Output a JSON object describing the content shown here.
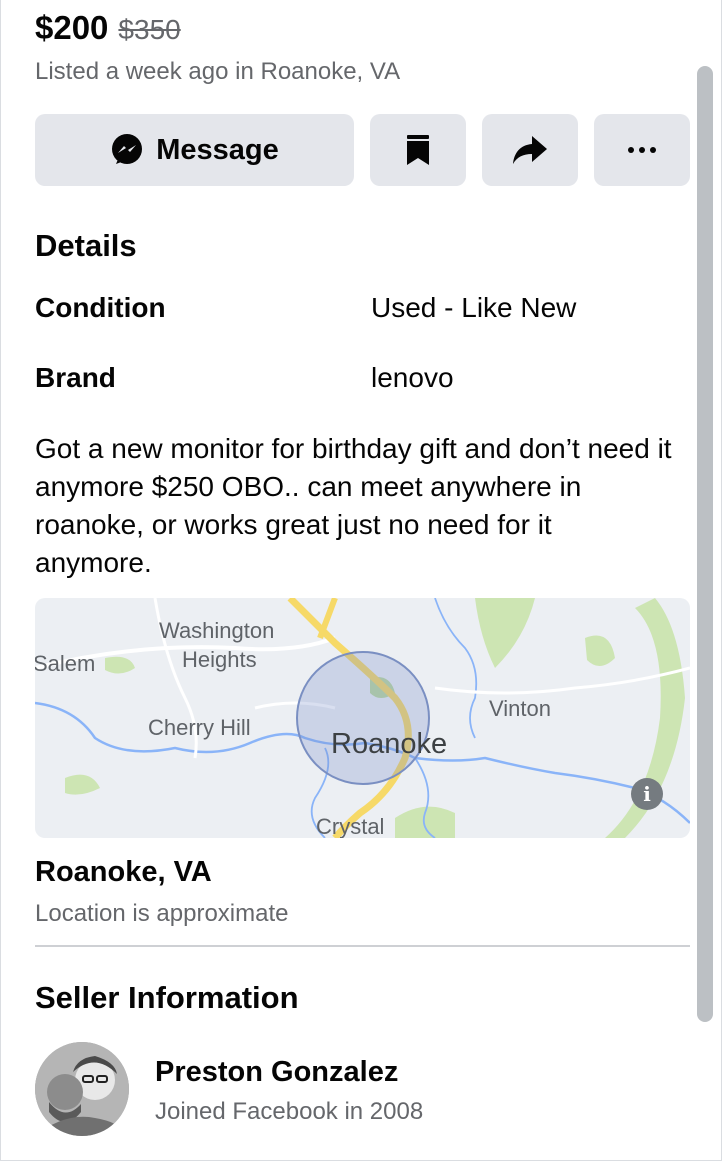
{
  "listing": {
    "price": "$200",
    "original_price": "$350",
    "listed_text": "Listed a week ago in Roanoke, VA"
  },
  "actions": {
    "message_label": "Message",
    "message_icon": "messenger-icon",
    "save_icon": "bookmark-icon",
    "share_icon": "share-arrow-icon",
    "more_icon": "more-dots-icon"
  },
  "details": {
    "title": "Details",
    "rows": [
      {
        "label": "Condition",
        "value": "Used - Like New"
      },
      {
        "label": "Brand",
        "value": "lenovo"
      }
    ],
    "description": "Got a new monitor for birthday gift and don’t need it anymore $250 OBO.. can meet anywhere in roanoke, or works great just no need for it anymore."
  },
  "map": {
    "labels": {
      "washington": "Washington",
      "heights": "Heights",
      "salem": "Salem",
      "cherry_hill": "Cherry Hill",
      "vinton": "Vinton",
      "roanoke": "Roanoke",
      "crystal": "Crystal"
    },
    "info_label": "i"
  },
  "location": {
    "title": "Roanoke, VA",
    "subtitle": "Location is approximate"
  },
  "seller": {
    "section_title": "Seller Information",
    "name": "Preston Gonzalez",
    "joined": "Joined Facebook in 2008"
  },
  "colors": {
    "accent_button_bg": "#e4e6eb",
    "secondary_text": "#65676b",
    "map_water": "#8ab4f8",
    "map_road": "#f6d968",
    "map_park": "#cde5b3"
  }
}
